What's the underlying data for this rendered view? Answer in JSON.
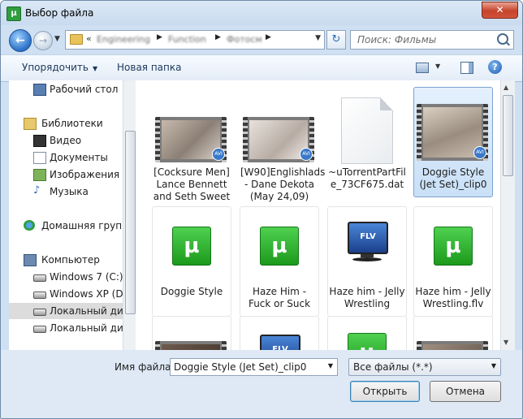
{
  "window": {
    "title": "Выбор файла",
    "app_icon": "µ"
  },
  "navbar": {
    "back_glyph": "←",
    "forward_glyph": "→",
    "address_chevron": "«",
    "breadcrumbs": [
      "Engineering",
      "Function",
      "Фотосм"
    ],
    "refresh_glyph": "↻",
    "search_placeholder": "Поиск: Фильмы"
  },
  "toolbar": {
    "organize": "Упорядочить",
    "new_folder": "Новая папка",
    "help": "?"
  },
  "nav": {
    "desktop": "Рабочий стол",
    "libraries": "Библиотеки",
    "video": "Видео",
    "documents": "Документы",
    "images": "Изображения",
    "music": "Музыка",
    "homegroup": "Домашняя группа",
    "computer": "Компьютер",
    "drives": [
      "Windows 7 (C:)",
      "Windows XP (D:)",
      "Локальный диск",
      "Локальный диск"
    ]
  },
  "files": [
    {
      "name": "[Cocksure Men] Lance Bennett and Seth Sweet",
      "icon": "video-thumbnail",
      "selected": false
    },
    {
      "name": "[W90]Englishlads - Dane Dekota (May 24,09)",
      "icon": "video-thumbnail",
      "selected": false
    },
    {
      "name": "~uTorrentPartFile_73CF675.dat",
      "icon": "blank-document",
      "selected": false
    },
    {
      "name": "Doggie Style (Jet Set)_clip0",
      "icon": "video-thumbnail",
      "selected": true
    },
    {
      "name": "Doggie Style",
      "icon": "utorrent",
      "selected": false
    },
    {
      "name": "Haze Him - Fuck or Suck",
      "icon": "utorrent",
      "selected": false
    },
    {
      "name": "Haze him - Jelly Wrestling",
      "icon": "flv-monitor",
      "selected": false
    },
    {
      "name": "Haze him - Jelly Wrestling.flv",
      "icon": "utorrent",
      "selected": false
    }
  ],
  "icons": {
    "utorrent_glyph": "µ",
    "flv_glyph": "FLV",
    "video_badge": "AVI"
  },
  "bottom": {
    "filename_label": "Имя файла:",
    "filename_value": "Doggie Style (Jet Set)_clip0",
    "filter_value": "Все файлы (*.*)",
    "open_button": "Открыть",
    "cancel_button": "Отмена"
  }
}
